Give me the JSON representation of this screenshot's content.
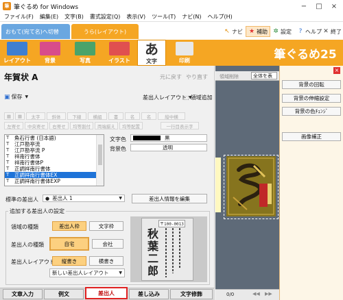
{
  "window": {
    "title": "筆ぐるめ for Windows",
    "minimize": "−",
    "maximize": "□",
    "close": "×"
  },
  "menu": [
    "ファイル(F)",
    "編集(E)",
    "文字(B)",
    "書式設定(Q)",
    "表示(V)",
    "ツール(T)",
    "ナビ(N)",
    "ヘルプ(H)"
  ],
  "mode_tabs": {
    "front": "おもて(宛て名)へ切替",
    "back": "うら(レイアウト)"
  },
  "top_buttons": {
    "navi": "ナビ",
    "help_assist": "補助",
    "settings": "設定",
    "help": "ヘルプ",
    "exit": "終了"
  },
  "categories": [
    "レイアウト",
    "背景",
    "写真",
    "イラスト",
    "文字",
    "印刷"
  ],
  "moji_glyph": "あ",
  "brand": "筆ぐるめ25",
  "doc": {
    "title": "年賀状 A",
    "undo": "元に戻す",
    "redo": "やり直す",
    "save": "保存",
    "sender_layout": "差出人レイアウト",
    "area_add": "領域追加"
  },
  "format_row1": [
    "太字",
    "斜体",
    "下線",
    "横組",
    "書",
    "名",
    "名"
  ],
  "format_row2": [
    "左寄せ",
    "中央寄せ",
    "右寄せ",
    "均等割付",
    "両端揃え",
    "均等配置"
  ],
  "format_row1_right": "縦中横",
  "format_row2_right": "一行目表示字",
  "fonts": [
    "魚石行書 (日本語)",
    "江戸勘亭流",
    "江戸勘亭流 P",
    "祥南行書体",
    "祥南行書体P",
    "正調祥南行書体",
    "正調祥南行書体EX",
    "正調祥南行書体EXP"
  ],
  "font_selected_index": 6,
  "color": {
    "text_label": "文字色",
    "text_value": "黒",
    "bg_label": "背景色",
    "bg_value": "透明"
  },
  "sender": {
    "label": "標準の差出人",
    "value": "差出人 1",
    "edit_button": "差出人情報を編集"
  },
  "group": {
    "title": "追加する差出人の設定",
    "area_type_label": "領域の種類",
    "area_type_options": [
      "差出人枠",
      "文字枠"
    ],
    "sender_type_label": "差出人の種類",
    "sender_type_options": [
      "自宅",
      "会社"
    ],
    "layout_label": "差出人レイアウト",
    "layout_options": [
      "縦書き",
      "横書き"
    ],
    "new_layout": "新しい差出人レイアウト"
  },
  "preview": {
    "postal": "〒100-0013",
    "name_chars": [
      "秋",
      "葉",
      "二",
      "郎"
    ]
  },
  "bottom_tabs": [
    "文章入力",
    "例文",
    "差出人",
    "差し込み",
    "文字修飾"
  ],
  "canvas": {
    "delete_area": "領域削除",
    "zoom_select": "全体を表",
    "page": "0/0"
  },
  "right_panel": {
    "buttons": [
      "背景の回転",
      "背景の伸縮設定",
      "背景の色ﾁｪﾝｼﾞ",
      "画像補正"
    ]
  },
  "colors": {
    "accent_orange": "#f5a623",
    "tab_blue": "#6aa7e0",
    "selected_blue": "#1e73d8",
    "highlight_red": "#e02020"
  }
}
